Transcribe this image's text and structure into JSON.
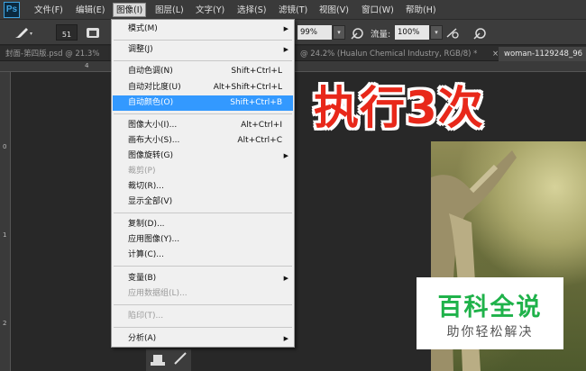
{
  "menubar": {
    "logo": "Ps",
    "items": [
      "文件(F)",
      "编辑(E)",
      "图像(I)",
      "图层(L)",
      "文字(Y)",
      "选择(S)",
      "滤镜(T)",
      "视图(V)",
      "窗口(W)",
      "帮助(H)"
    ]
  },
  "options": {
    "brush_size": "51",
    "opacity_value": "99%",
    "flow_label": "流量:",
    "flow_value": "100%"
  },
  "tabs": [
    "封面-第四版.psd @ 21.3%",
    "@ 24.2% (Hualun Chemical Industry, RGB/8) *",
    "woman-1129248_96"
  ],
  "ruler": {
    "top": [
      "4"
    ],
    "left": [
      "0",
      "1",
      "2"
    ]
  },
  "image_menu": {
    "items": [
      {
        "label": "模式(M)",
        "shortcut": "",
        "submenu": true
      },
      {
        "label": "调整(J)",
        "shortcut": "",
        "submenu": true
      },
      {
        "label": "自动色调(N)",
        "shortcut": "Shift+Ctrl+L"
      },
      {
        "label": "自动对比度(U)",
        "shortcut": "Alt+Shift+Ctrl+L"
      },
      {
        "label": "自动颜色(O)",
        "shortcut": "Shift+Ctrl+B"
      },
      {
        "label": "图像大小(I)...",
        "shortcut": "Alt+Ctrl+I"
      },
      {
        "label": "画布大小(S)...",
        "shortcut": "Alt+Ctrl+C"
      },
      {
        "label": "图像旋转(G)",
        "shortcut": "",
        "submenu": true
      },
      {
        "label": "裁剪(P)",
        "shortcut": ""
      },
      {
        "label": "裁切(R)...",
        "shortcut": ""
      },
      {
        "label": "显示全部(V)",
        "shortcut": ""
      },
      {
        "label": "复制(D)...",
        "shortcut": ""
      },
      {
        "label": "应用图像(Y)...",
        "shortcut": ""
      },
      {
        "label": "计算(C)...",
        "shortcut": ""
      },
      {
        "label": "变量(B)",
        "shortcut": "",
        "submenu": true
      },
      {
        "label": "应用数据组(L)...",
        "shortcut": ""
      },
      {
        "label": "陷印(T)...",
        "shortcut": ""
      },
      {
        "label": "分析(A)",
        "shortcut": "",
        "submenu": true
      }
    ]
  },
  "overlay": {
    "title": "执行3次",
    "badge_title": "百科全说",
    "badge_subtitle": "助你轻松解决"
  },
  "colors": {
    "highlight": "#3399ff",
    "title_red": "#e8281a",
    "badge_green": "#1fb24a"
  }
}
